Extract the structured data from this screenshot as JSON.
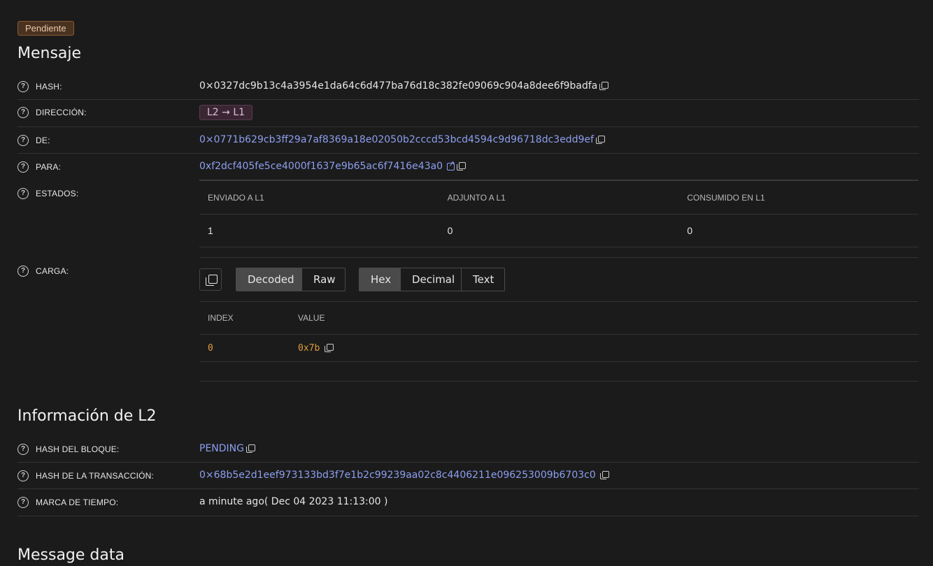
{
  "status_badge": "Pendiente",
  "message_section": {
    "title": "Mensaje",
    "hash": {
      "label": "HASH:",
      "value": "0×0327dc9b13c4a3954e1da64c6d477ba76d18c382fe09069c904a8dee6f9badfa"
    },
    "direction": {
      "label": "DIRECCIÓN:",
      "value": "L2 → L1"
    },
    "from": {
      "label": "DE:",
      "value": "0×0771b629cb3ff29a7af8369a18e02050b2cccd53bcd4594c9d96718dc3edd9ef"
    },
    "to": {
      "label": "PARA:",
      "value": "0xf2dcf405fe5ce4000f1637e9b65ac6f7416e43a0"
    },
    "states": {
      "label": "ESTADOS:",
      "headers": [
        "ENVIADO A L1",
        "ADJUNTO A L1",
        "CONSUMIDO EN L1"
      ],
      "values": [
        "1",
        "0",
        "0"
      ]
    },
    "payload": {
      "label": "CARGA:",
      "format_buttons": [
        "Decoded",
        "Raw"
      ],
      "format_active": "Decoded",
      "encoding_buttons": [
        "Hex",
        "Decimal",
        "Text"
      ],
      "encoding_active": "Hex",
      "columns": [
        "INDEX",
        "VALUE"
      ],
      "rows": [
        {
          "index": "0",
          "value": "0x7b"
        }
      ]
    }
  },
  "l2_section": {
    "title": "Información de L2",
    "block_hash": {
      "label": "HASH DEL BLOQUE:",
      "value": "PENDING"
    },
    "tx_hash": {
      "label": "HASH DE LA TRANSACCIÓN:",
      "value": "0×68b5e2d1eef973133bd3f7e1b2c99239aa02c8c4406211e096253009b6703c0"
    },
    "timestamp": {
      "label": "MARCA DE TIEMPO:",
      "relative": "a minute ago",
      "absolute": "( Dec 04 2023 11:13:00 )"
    }
  },
  "message_data_section": {
    "title": "Message data"
  },
  "colors": {
    "link": "#8d9ff0",
    "payload_value": "#e09a3e",
    "badge_bg": "#4a3221"
  }
}
